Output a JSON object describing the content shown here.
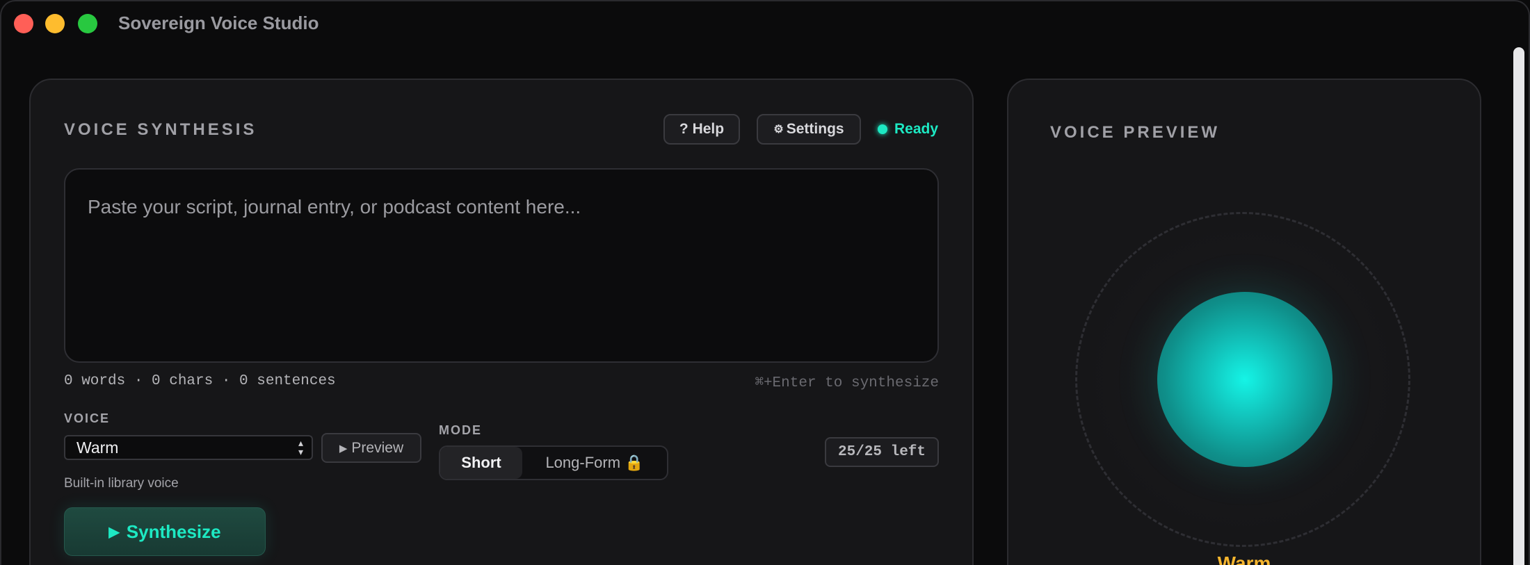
{
  "window": {
    "title": "Sovereign Voice Studio"
  },
  "synthesis": {
    "section_title": "VOICE SYNTHESIS",
    "help_label": "? Help",
    "settings_label": "Settings",
    "status": "Ready",
    "script_placeholder": "Paste your script, journal entry, or podcast content here...",
    "counts": "0 words · 0 chars · 0 sentences",
    "shortcut_hint": "⌘+Enter to synthesize",
    "voice_label": "VOICE",
    "voice_value": "Warm",
    "preview_label": "Preview",
    "voice_hint": "Built-in library voice",
    "mode_label": "MODE",
    "mode_short": "Short",
    "mode_long": "Long-Form 🔒",
    "quota": "25/25 left",
    "synthesize_label": "Synthesize"
  },
  "preview": {
    "section_title": "VOICE PREVIEW",
    "voice_name": "Warm"
  },
  "icons": {
    "settings": "gear-icon",
    "preview": "play-icon",
    "synthesize": "play-icon",
    "select": "chevron-updown-icon"
  },
  "colors": {
    "accent": "#1de9c3",
    "voice_name": "#f5b52e",
    "background": "#0b0b0c",
    "panel": "#161618"
  }
}
